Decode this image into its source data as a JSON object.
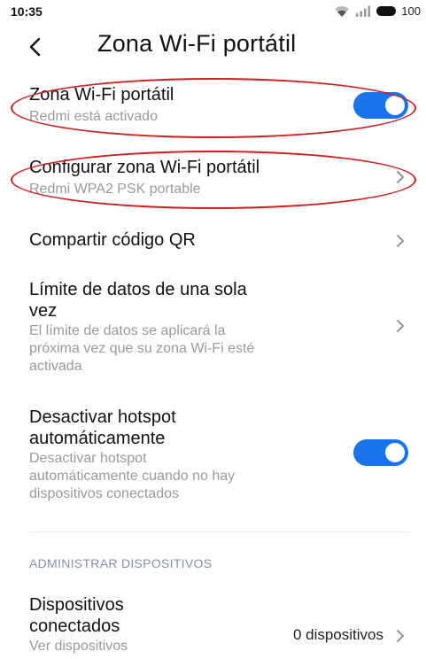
{
  "status_bar": {
    "time": "10:35",
    "battery": "100"
  },
  "header": {
    "title": "Zona Wi-Fi portátil"
  },
  "settings": {
    "hotspot": {
      "title": "Zona Wi-Fi portátil",
      "subtitle": "Redmi está activado",
      "enabled": true
    },
    "configure": {
      "title": "Configurar zona Wi-Fi portátil",
      "subtitle": "Redmi WPA2 PSK portable"
    },
    "share_qr": {
      "title": "Compartir código QR"
    },
    "data_limit": {
      "title_line1": "Límite de datos de una sola",
      "title_line2": "vez",
      "sub_line1": "El límite de datos se aplicará la",
      "sub_line2": "próxima vez que su zona Wi-Fi esté",
      "sub_line3": "activada"
    },
    "auto_off": {
      "title_line1": "Desactivar hotspot",
      "title_line2": "automáticamente",
      "sub_line1": "Desactivar hotspot",
      "sub_line2": "automáticamente cuando no hay",
      "sub_line3": "dispositivos conectados",
      "enabled": true
    }
  },
  "manage_section": {
    "header": "ADMINISTRAR DISPOSITIVOS",
    "connected": {
      "title_line1": "Dispositivos",
      "title_line2": "conectados",
      "subtitle": "Ver dispositivos",
      "value": "0 dispositivos"
    }
  },
  "colors": {
    "toggle_on": "#1a73e8",
    "annotation": "#cc1f1f"
  }
}
